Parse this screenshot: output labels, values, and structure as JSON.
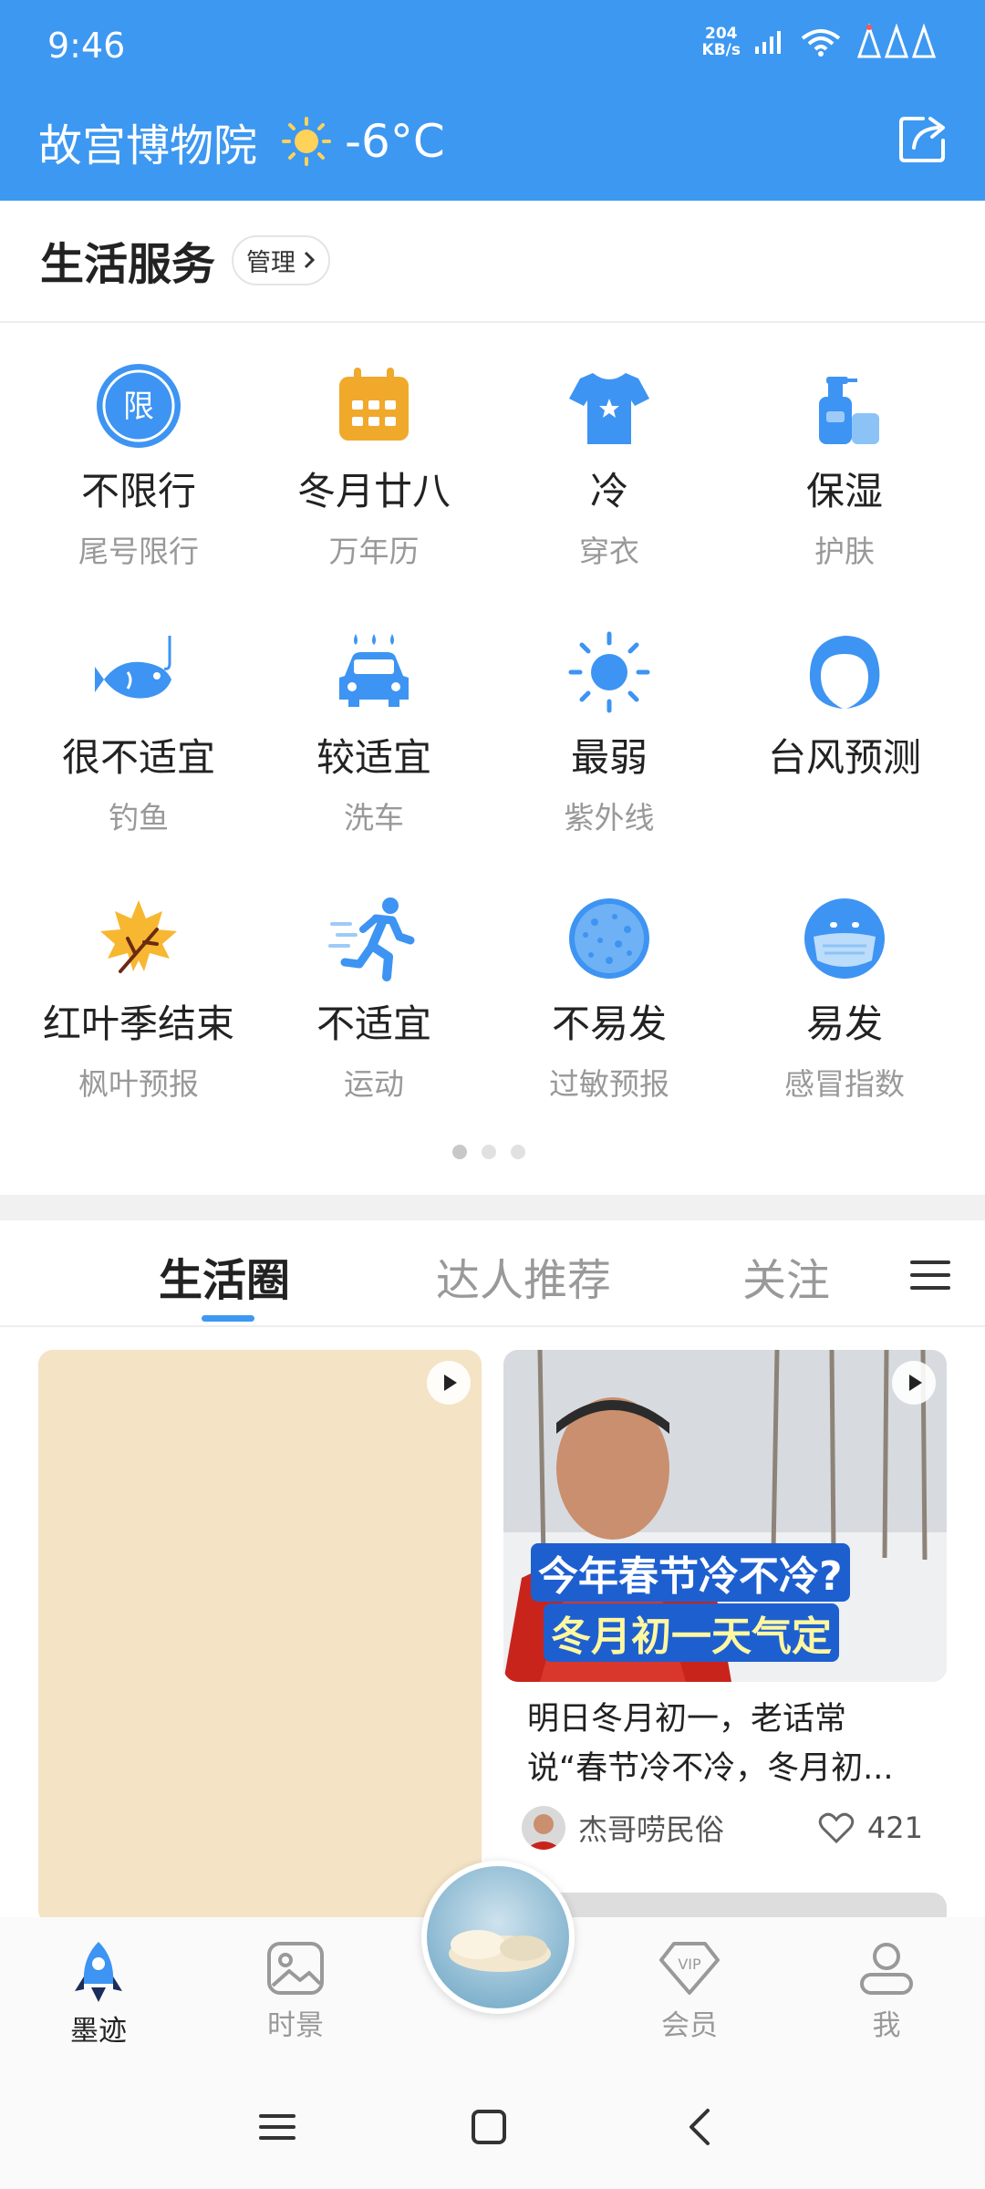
{
  "status_bar": {
    "time": "9:46",
    "net_speed_value": "204",
    "net_speed_unit": "KB/s"
  },
  "header": {
    "location": "故宫博物院",
    "weather_icon": "sun-icon",
    "temperature": "-6°C"
  },
  "services": {
    "title": "生活服务",
    "manage_label": "管理",
    "items": [
      {
        "main": "不限行",
        "sub": "尾号限行",
        "icon": "restriction-icon"
      },
      {
        "main": "冬月廿八",
        "sub": "万年历",
        "icon": "calendar-icon"
      },
      {
        "main": "冷",
        "sub": "穿衣",
        "icon": "tshirt-icon"
      },
      {
        "main": "保湿",
        "sub": "护肤",
        "icon": "skincare-icon"
      },
      {
        "main": "很不适宜",
        "sub": "钓鱼",
        "icon": "fish-icon"
      },
      {
        "main": "较适宜",
        "sub": "洗车",
        "icon": "car-wash-icon"
      },
      {
        "main": "最弱",
        "sub": "紫外线",
        "icon": "uv-sun-icon"
      },
      {
        "main": "台风预测",
        "sub": "",
        "icon": "typhoon-icon"
      },
      {
        "main": "红叶季结束",
        "sub": "枫叶预报",
        "icon": "maple-leaf-icon"
      },
      {
        "main": "不适宜",
        "sub": "运动",
        "icon": "running-icon"
      },
      {
        "main": "不易发",
        "sub": "过敏预报",
        "icon": "pollen-icon"
      },
      {
        "main": "易发",
        "sub": "感冒指数",
        "icon": "mask-face-icon"
      }
    ],
    "page_indicator": {
      "pages": 3,
      "active_page": 1
    }
  },
  "feed_tabs": {
    "tab1": "生活圈",
    "tab2": "达人推荐",
    "tab3": "关注",
    "active": "生活圈"
  },
  "feed": {
    "right_card": {
      "overlay_line1": "今年春节冷不冷?",
      "overlay_line2": "冬月初一天气定",
      "text": "明日冬月初一，老话常说“春节冷不冷，冬月初...",
      "author": "杰哥唠民俗",
      "likes": "421"
    }
  },
  "bottom_nav": {
    "items": [
      {
        "label": "墨迹",
        "icon": "rocket-icon"
      },
      {
        "label": "时景",
        "icon": "image-icon"
      },
      {
        "label": "会员",
        "icon": "vip-icon"
      },
      {
        "label": "我",
        "icon": "user-icon"
      }
    ],
    "active": "墨迹"
  },
  "colors": {
    "accent": "#3d98f1",
    "icon_blue": "#3d94f2",
    "calendar_orange": "#f0a92b",
    "card_beige": "#f4e3c5"
  }
}
